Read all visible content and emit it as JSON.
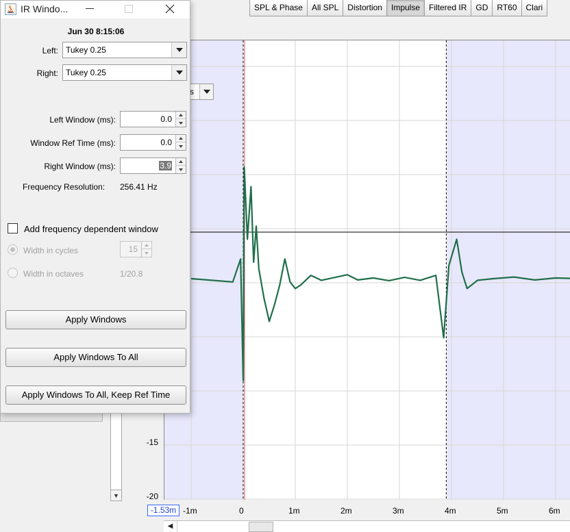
{
  "tabs": [
    "SPL & Phase",
    "All SPL",
    "Distortion",
    "Impulse",
    "Filtered IR",
    "GD",
    "RT60",
    "Clari"
  ],
  "active_tab": "Impulse",
  "dialog": {
    "title": "IR Windo...",
    "timestamp": "Jun 30 8:15:06",
    "left_label": "Left:",
    "left_value": "Tukey 0.25",
    "right_label": "Right:",
    "right_value": "Tukey 0.25",
    "left_window_label": "Left Window (ms):",
    "left_window_value": "0.0",
    "ref_time_label": "Window Ref Time (ms):",
    "ref_time_value": "0.0",
    "right_window_label": "Right Window (ms):",
    "right_window_value": "3.9",
    "freq_res_label": "Frequency Resolution:",
    "freq_res_value": "256.41 Hz",
    "freq_dep_label": "Add frequency dependent window",
    "cycles_label": "Width in cycles",
    "cycles_value": "15",
    "octaves_label": "Width in octaves",
    "octaves_value": "1/20.8",
    "btn_apply": "Apply Windows",
    "btn_apply_all": "Apply Windows To All",
    "btn_apply_all_keep": "Apply Windows To All, Keep Ref Time"
  },
  "plot": {
    "units_selector": "s",
    "x_start_field": "-1.53m",
    "y_ticks": [
      "-15",
      "-20"
    ],
    "x_ticks": [
      "-1m",
      "0",
      "1m",
      "2m",
      "3m",
      "4m",
      "5m",
      "6m"
    ],
    "colors": {
      "trace": "#1f6e4a",
      "window_shade": "#e8e8fc",
      "grid": "#d6d6d6"
    }
  },
  "chart_data": {
    "type": "line",
    "xlabel": "",
    "ylabel": "",
    "x_unit": "s",
    "window_left_ms": 0.0,
    "window_right_ms": 3.9,
    "series": [
      {
        "x_ms": [
          -1.0,
          -0.6,
          -0.2,
          -0.05,
          0.0,
          0.02,
          0.08,
          0.15,
          0.2,
          0.25,
          0.3,
          0.4,
          0.5,
          0.6,
          0.7,
          0.8,
          0.9,
          1.0,
          1.1,
          1.3,
          1.5,
          1.8,
          2.0,
          2.2,
          2.5,
          2.8,
          3.1,
          3.4,
          3.7,
          3.85,
          3.95,
          4.1,
          4.2,
          4.3,
          4.5,
          4.8,
          5.2,
          5.6,
          6.0,
          6.5
        ],
        "y_rel": [
          0.0,
          -0.05,
          -0.1,
          0.6,
          -3.1,
          3.4,
          1.2,
          2.8,
          0.5,
          1.6,
          0.3,
          -0.6,
          -1.3,
          -0.8,
          -0.2,
          0.6,
          -0.1,
          -0.3,
          -0.2,
          0.1,
          -0.05,
          0.05,
          0.12,
          -0.04,
          0.02,
          -0.06,
          0.04,
          -0.05,
          0.1,
          -1.8,
          0.4,
          1.2,
          0.2,
          -0.3,
          -0.05,
          0.0,
          0.05,
          -0.04,
          0.02,
          0.0
        ]
      }
    ]
  }
}
